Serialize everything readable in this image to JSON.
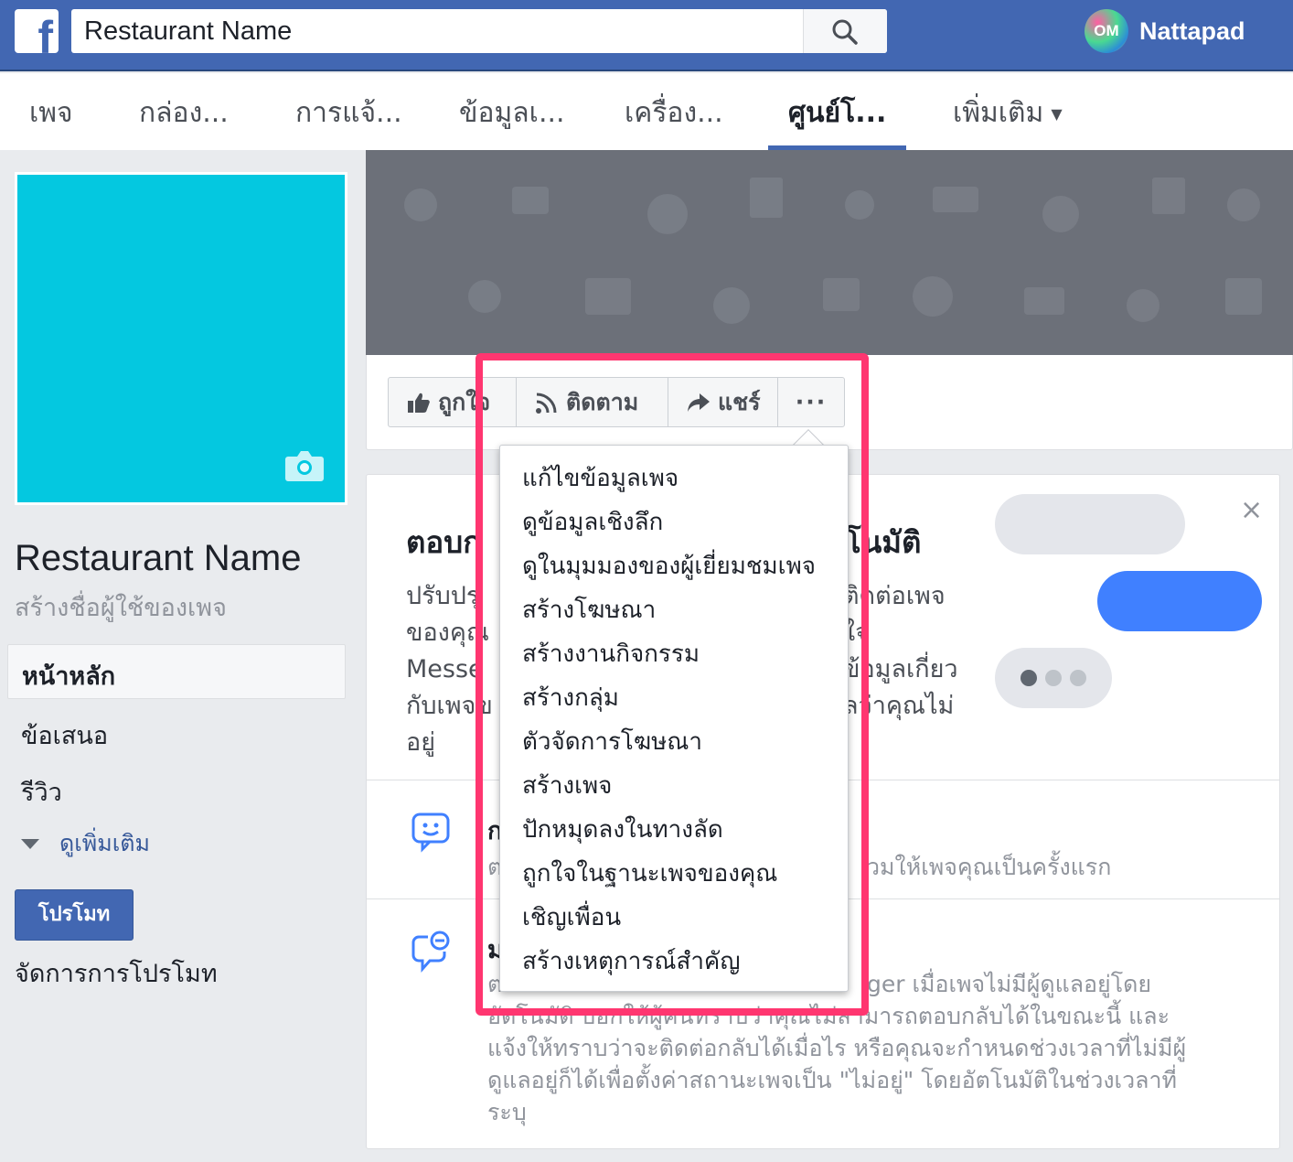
{
  "topbar": {
    "logo_letter": "f",
    "search_value": "Restaurant Name",
    "search_icon": "search-icon",
    "avatar_text": "OM",
    "username": "Nattapad",
    "color": "#4267b2"
  },
  "tabs": [
    {
      "label": "เพจ"
    },
    {
      "label": "กล่อง..."
    },
    {
      "label": "การแจ้..."
    },
    {
      "label": "ข้อมูลเ..."
    },
    {
      "label": "เครื่อง..."
    },
    {
      "label": "ศูนย์โ...",
      "active": true
    },
    {
      "label": "เพิ่มเติม"
    }
  ],
  "sidebar": {
    "profile_color": "#04c8e0",
    "camera_icon": "camera-icon",
    "page_name": "Restaurant Name",
    "create_username": "สร้างชื่อผู้ใช้ของเพจ",
    "nav": [
      "หน้าหลัก",
      "ข้อเสนอ",
      "รีวิว"
    ],
    "see_more": "ดูเพิ่มเติม",
    "promote_button": "โปรโมท",
    "manage_promotions": "จัดการการโปรโมท"
  },
  "actions": {
    "like": "ถูกใจ",
    "follow": "ติดตาม",
    "share": "แชร์",
    "more": "···"
  },
  "menu": {
    "items": [
      "แก้ไขข้อมูลเพจ",
      "ดูข้อมูลเชิงลึก",
      "ดูในมุมมองของผู้เยี่ยมชมเพจ",
      "สร้างโฆษณา",
      "สร้างงานกิจกรรม",
      "สร้างกลุ่ม",
      "ตัวจัดการโฆษณา",
      "สร้างเพจ",
      "ปักหมุดลงในทางลัด",
      "ถูกใจในฐานะเพจของคุณ",
      "เชิญเพื่อน",
      "สร้างเหตุการณ์สำคัญ"
    ]
  },
  "card": {
    "close": "×",
    "title_left": "ตอบก",
    "title_right": "โนมัติ",
    "desc_lines_left": [
      "ปรับปรุ",
      "ของคุณ",
      "Messe",
      "กับเพจข",
      "อยู่"
    ],
    "desc_lines_right": [
      "ติดต่อเพจ",
      "ใจ",
      "ข้อมูลเกี่ยว",
      "ลว่าคุณไม่",
      ""
    ],
    "row1_title": "ก",
    "row1_sub_left": "ต",
    "row1_sub_right": "วมให้เพจคุณเป็นครั้งแรก",
    "row2_title": "ม",
    "row2_sub_line1_left": "ต",
    "row2_sub_line1_right": "ger เมื่อเพจไม่มีผู้ดูแลอยู่โดย",
    "row2_sub_line2": "อัตโนมัติ บอกให้ผู้คนทราบว่าคุณไม่สามารถตอบกลับได้ในขณะนี้ และ",
    "row2_sub_line3": "แจ้งให้ทราบว่าจะติดต่อกลับได้เมื่อไร หรือคุณจะกำหนดช่วงเวลาที่ไม่มีผู้",
    "row2_sub_line4": "ดูแลอยู่ก็ได้เพื่อตั้งค่าสถานะเพจเป็น \"ไม่อยู่\" โดยอัตโนมัติในช่วงเวลาที่",
    "row2_sub_line5": "ระบุ"
  },
  "highlight_color": "#ff3670"
}
